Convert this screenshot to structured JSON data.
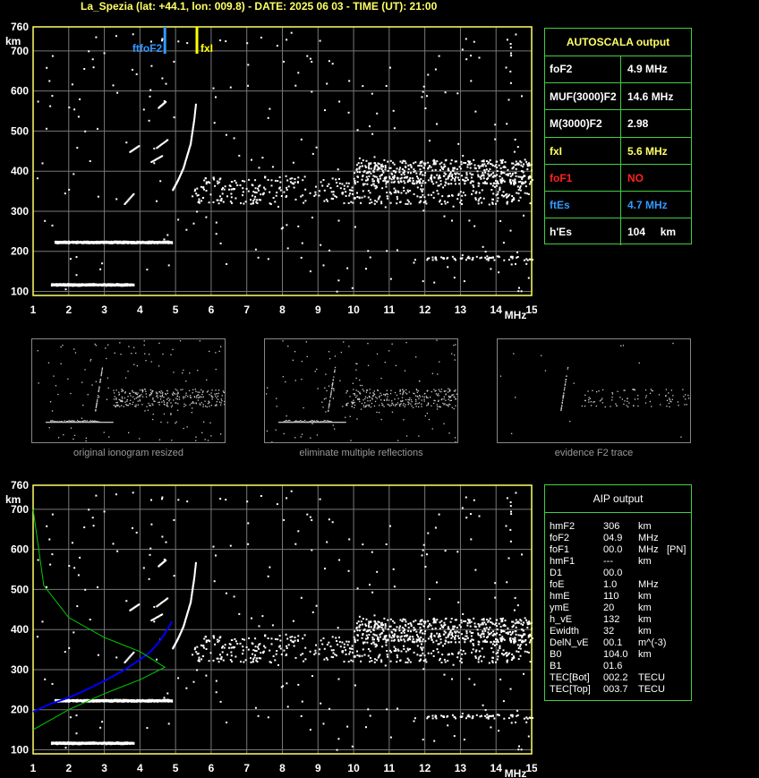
{
  "title": "La_Spezia (lat: +44.1, lon: 009.8) - DATE: 2025 06 03 - TIME (UT): 21:00",
  "colors": {
    "axis": "#ffff66",
    "grid": "#777777",
    "trace": "#ffffff",
    "panel_border": "#44cc44",
    "foF2_marker": "#3399ff",
    "fxI_marker": "#ffff00",
    "profile": "#0000ff",
    "density": "#00cc00"
  },
  "chart_data": [
    {
      "type": "scatter",
      "name_ref": "top-ionogram",
      "xlabel": "MHz",
      "ylabel": "km",
      "xlim": [
        1,
        15
      ],
      "ylim": [
        90,
        760
      ],
      "x_ticks": [
        "1",
        "2",
        "3",
        "4",
        "5",
        "6",
        "7",
        "8",
        "9",
        "10",
        "11",
        "12",
        "13",
        "14",
        "15"
      ],
      "y_ticks": [
        "100",
        "200",
        "300",
        "400",
        "500",
        "600",
        "700",
        "760"
      ],
      "grid": true,
      "markers": [
        {
          "label": "ftfoF2",
          "freq": 4.7,
          "color": "#3399ff"
        },
        {
          "label": "fxI",
          "freq": 5.6,
          "color": "#ffff00"
        }
      ],
      "traces": {
        "es_2hop": {
          "x": [
            1.5,
            3.8
          ],
          "h": 119
        },
        "es_1hop": {
          "x": [
            1.6,
            4.9
          ],
          "h": 225
        },
        "f2_o": [
          [
            4.9,
            355
          ],
          [
            5.05,
            380
          ],
          [
            5.2,
            410
          ],
          [
            5.3,
            440
          ],
          [
            5.4,
            470
          ],
          [
            5.45,
            500
          ],
          [
            5.5,
            530
          ],
          [
            5.55,
            570
          ]
        ],
        "f2_x_fragments": [
          [
            [
              3.55,
              320
            ],
            [
              3.8,
              345
            ]
          ],
          [
            [
              4.3,
              425
            ],
            [
              4.6,
              440
            ]
          ],
          [
            [
              4.45,
              460
            ],
            [
              4.75,
              480
            ]
          ],
          [
            [
              4.5,
              560
            ],
            [
              4.7,
              575
            ]
          ],
          [
            [
              3.7,
              450
            ],
            [
              3.95,
              465
            ]
          ]
        ],
        "noise_bands": [
          {
            "x": [
              5.5,
              15
            ],
            "h": [
              320,
              390
            ]
          },
          {
            "x": [
              10,
              15
            ],
            "h": [
              370,
              430
            ]
          }
        ]
      }
    },
    {
      "type": "scatter",
      "name_ref": "bottom-ionogram",
      "xlabel": "MHz",
      "ylabel": "km",
      "xlim": [
        1,
        15
      ],
      "ylim": [
        90,
        760
      ],
      "x_ticks": [
        "1",
        "2",
        "3",
        "4",
        "5",
        "6",
        "7",
        "8",
        "9",
        "10",
        "11",
        "12",
        "13",
        "14",
        "15"
      ],
      "y_ticks": [
        "100",
        "200",
        "300",
        "400",
        "500",
        "600",
        "700",
        "760"
      ],
      "grid": true,
      "profile": [
        [
          1.0,
          195
        ],
        [
          1.5,
          215
        ],
        [
          2.0,
          230
        ],
        [
          2.5,
          250
        ],
        [
          3.0,
          272
        ],
        [
          3.5,
          296
        ],
        [
          4.0,
          325
        ],
        [
          4.3,
          345
        ],
        [
          4.5,
          365
        ],
        [
          4.7,
          390
        ],
        [
          4.9,
          420
        ]
      ],
      "density_curve": [
        [
          1.0,
          150
        ],
        [
          2.0,
          200
        ],
        [
          3.0,
          240
        ],
        [
          4.0,
          275
        ],
        [
          4.7,
          306
        ],
        [
          4.0,
          345
        ],
        [
          3.0,
          380
        ],
        [
          2.0,
          430
        ],
        [
          1.3,
          510
        ],
        [
          1.0,
          700
        ]
      ]
    }
  ],
  "autoscala": {
    "header": "AUTOSCALA output",
    "rows": [
      {
        "label": "foF2",
        "value": "4.9 MHz",
        "lcolor": "#ffffff",
        "vcolor": "#ffffff"
      },
      {
        "label": "MUF(3000)F2",
        "value": "14.6 MHz",
        "lcolor": "#ffffff",
        "vcolor": "#ffffff"
      },
      {
        "label": "M(3000)F2",
        "value": "2.98",
        "lcolor": "#ffffff",
        "vcolor": "#ffffff"
      },
      {
        "label": "fxI",
        "value": "5.6 MHz",
        "lcolor": "#ffff66",
        "vcolor": "#ffff66"
      },
      {
        "label": "foF1",
        "value": "NO",
        "lcolor": "#ff2222",
        "vcolor": "#ff2222"
      },
      {
        "label": "ftEs",
        "value": "4.7 MHz",
        "lcolor": "#3399ff",
        "vcolor": "#3399ff"
      },
      {
        "label": "h'Es",
        "value": "104     km",
        "lcolor": "#ffffff",
        "vcolor": "#ffffff"
      }
    ]
  },
  "thumbs": [
    {
      "caption": "original ionogram resized"
    },
    {
      "caption": "eliminate multiple reflections"
    },
    {
      "caption": "evidence F2 trace"
    }
  ],
  "aip": {
    "header": "AIP output",
    "rows": [
      [
        "hmF2",
        "306",
        "km",
        ""
      ],
      [
        "foF2",
        "04.9",
        "MHz",
        ""
      ],
      [
        "foF1",
        "00.0",
        "MHz",
        "[PN]"
      ],
      [
        "hmF1",
        "---",
        "km",
        ""
      ],
      [
        "D1",
        "00.0",
        "",
        ""
      ],
      [
        "foE",
        "1.0",
        "MHz",
        ""
      ],
      [
        "hmE",
        "110",
        "km",
        ""
      ],
      [
        "ymE",
        "20",
        "km",
        ""
      ],
      [
        "h_vE",
        "132",
        "km",
        ""
      ],
      [
        "Ewidth",
        "32",
        "km",
        ""
      ],
      [
        "DelN_vE",
        "00.1",
        "m^(-3)",
        ""
      ],
      [
        "B0",
        "104.0",
        "km",
        ""
      ],
      [
        "B1",
        "01.6",
        "",
        ""
      ],
      [
        "TEC[Bot]",
        "002.2",
        "TECU",
        ""
      ],
      [
        "TEC[Top]",
        "003.7",
        "TECU",
        ""
      ]
    ]
  }
}
